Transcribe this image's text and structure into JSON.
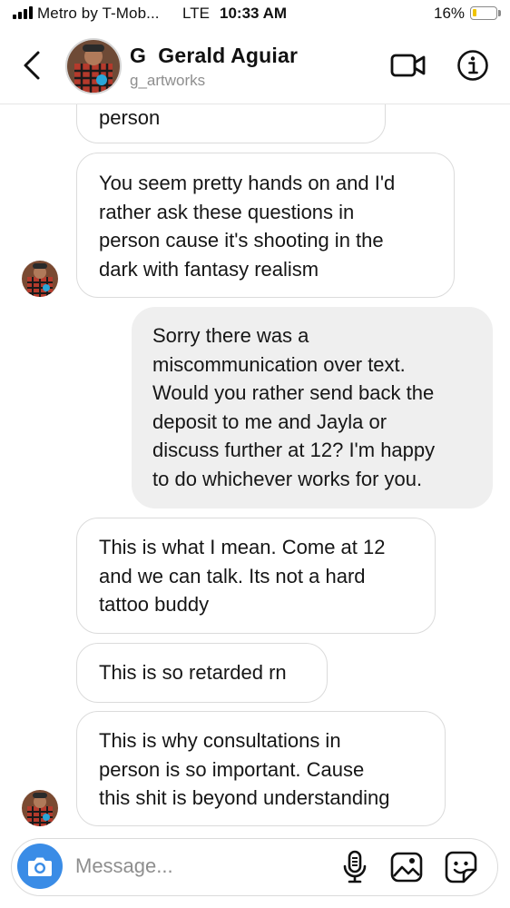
{
  "status_bar": {
    "carrier": "Metro by T-Mob...",
    "network": "LTE",
    "time": "10:33 AM",
    "battery_percent": "16%",
    "battery_level": 0.16,
    "signal_bars": 4
  },
  "header": {
    "display_name": "G  Gerald Aguiar",
    "username": "g_artworks",
    "back_icon": "chevron-left-icon",
    "video_icon": "video-camera-icon",
    "info_icon": "info-icon"
  },
  "messages": [
    {
      "direction": "received",
      "text": "person",
      "show_avatar": false
    },
    {
      "direction": "received",
      "text": "You seem pretty hands on and I'd\nrather ask these questions in\nperson cause it's shooting in the\ndark with fantasy realism",
      "show_avatar": true
    },
    {
      "direction": "sent",
      "text": "Sorry there was a\nmiscommunication over text.\nWould you rather send back the\ndeposit to me and Jayla or\ndiscuss further at 12? I'm happy\nto do whichever works for you.",
      "show_avatar": false
    },
    {
      "direction": "received",
      "text": "This is what I mean. Come at 12\nand we can talk. Its not a hard\ntattoo buddy",
      "show_avatar": false
    },
    {
      "direction": "received",
      "text": "This is so retarded rn",
      "show_avatar": false
    },
    {
      "direction": "received",
      "text": "This is why consultations in\nperson is so important. Cause\nthis shit is beyond understanding",
      "show_avatar": true
    }
  ],
  "composer": {
    "placeholder": "Message...",
    "camera_icon": "camera-icon",
    "mic_icon": "microphone-icon",
    "gallery_icon": "gallery-icon",
    "sticker_icon": "sticker-icon"
  },
  "colors": {
    "camera_button": "#3a8ce6",
    "sent_bubble": "#efefef",
    "received_border": "#dbdbdb",
    "secondary_text": "#8e8e8e",
    "battery_fill": "#f0c400"
  }
}
